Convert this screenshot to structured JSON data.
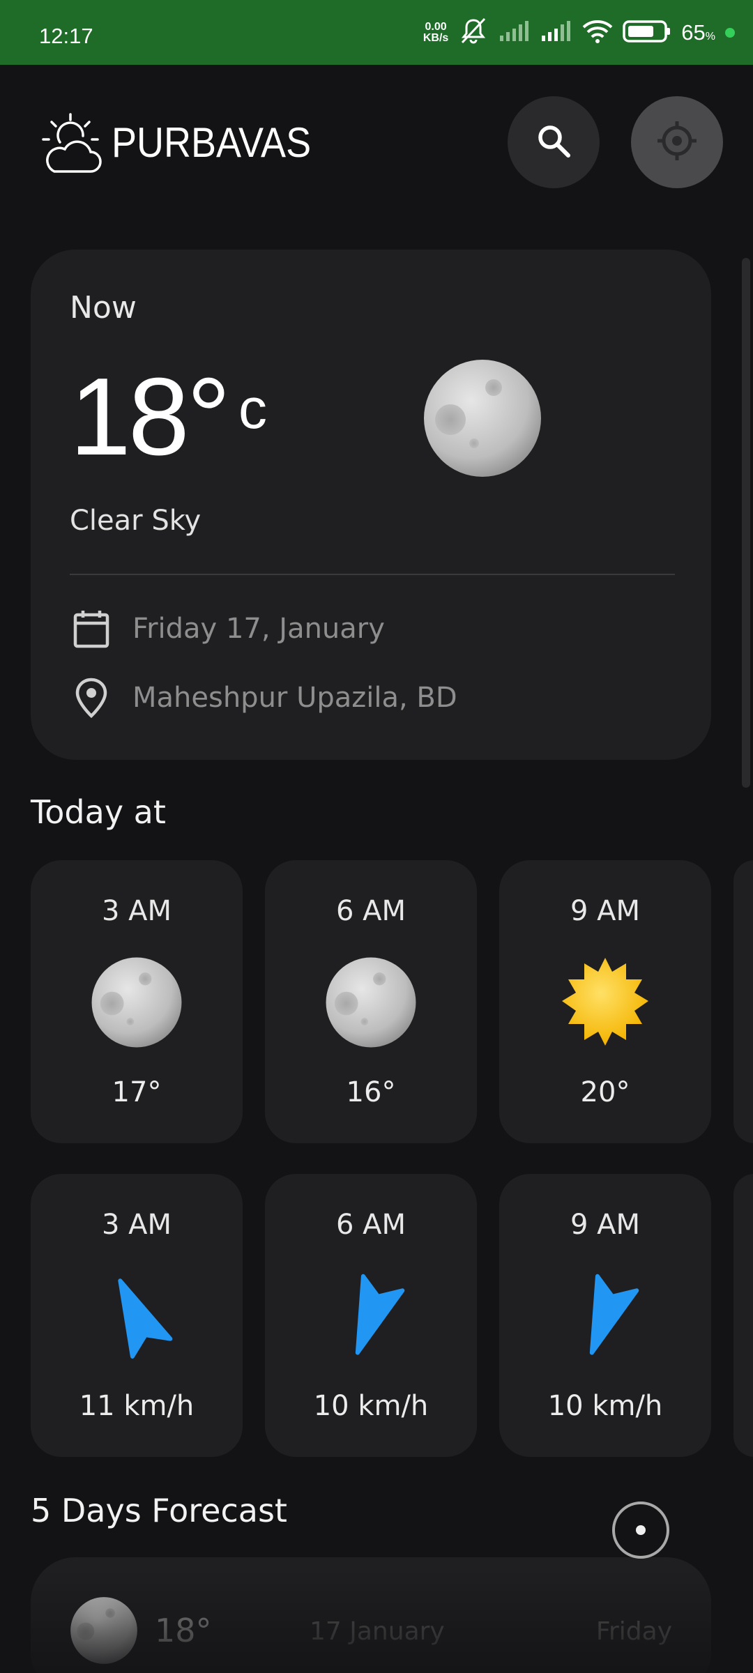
{
  "status_bar": {
    "time": "12:17",
    "net_speed_value": "0.00",
    "net_speed_unit": "KB/s",
    "battery_percent": "65",
    "battery_symbol": "%",
    "icons": [
      "mute-bell-icon",
      "signal-icon",
      "signal-icon",
      "wifi-icon",
      "battery-icon"
    ],
    "bar_color": "#1e6c28",
    "charging_dot_color": "#35d05a"
  },
  "header": {
    "app_name": "PURBAVAS",
    "logo_icon": "partly-cloudy-icon",
    "search_icon": "search-icon",
    "location_icon": "current-location-icon"
  },
  "now": {
    "label": "Now",
    "temperature": "18°",
    "unit": "c",
    "condition": "Clear Sky",
    "icon": "moon-icon",
    "date": "Friday 17, January",
    "date_icon": "calendar-icon",
    "location": "Maheshpur Upazila, BD",
    "location_icon": "location-pin-icon"
  },
  "today": {
    "title": "Today at",
    "temperature_cards": [
      {
        "time": "3 AM",
        "icon": "moon-icon",
        "value": "17°"
      },
      {
        "time": "6 AM",
        "icon": "moon-icon",
        "value": "16°"
      },
      {
        "time": "9 AM",
        "icon": "sun-icon",
        "value": "20°"
      }
    ],
    "wind_cards": [
      {
        "time": "3 AM",
        "icon": "wind-direction-icon",
        "value": "11 km/h"
      },
      {
        "time": "6 AM",
        "icon": "wind-direction-icon",
        "value": "10 km/h"
      },
      {
        "time": "9 AM",
        "icon": "wind-direction-icon",
        "value": "10 km/h"
      }
    ],
    "wind_color": "#2196f3",
    "sun_color": "#fbc02d"
  },
  "forecast": {
    "title": "5 Days Forecast",
    "days": [
      {
        "icon": "moon-icon",
        "temp": "18°",
        "date": "17 January",
        "day": "Friday"
      }
    ]
  },
  "theme": {
    "background": "#131315",
    "card": "#1f1f21",
    "muted_text": "#8e8e8e"
  }
}
